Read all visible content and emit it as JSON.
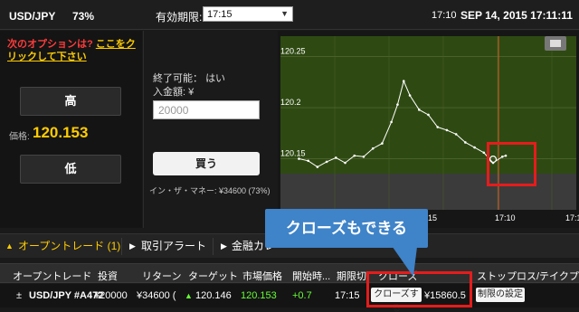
{
  "topbar": {
    "pair": "USD/JPY",
    "percent": "73%",
    "expiry_label": "有効期限:",
    "expiry_value": "17:15",
    "time_short": "17:10",
    "datetime": "SEP 14, 2015 17:11:11"
  },
  "left": {
    "promo_text": "次のオプションは?",
    "promo_link": "ここをクリックして下さい",
    "high_label": "高",
    "price_label": "価格:",
    "price_value": "120.153",
    "low_label": "低"
  },
  "mid": {
    "closable_label": "終了可能：",
    "closable_value": "はい",
    "amount_label": "入金額: ¥",
    "amount_placeholder": "20000",
    "buy_label": "買う",
    "in_the_money": "イン・ザ・マネー: ¥34600 (73%)"
  },
  "chart_data": {
    "type": "line",
    "series": [
      {
        "values": [
          {
            "x": "17:00",
            "y": 120.15
          },
          {
            "x": "17:00:30",
            "y": 120.148
          },
          {
            "x": "17:01",
            "y": 120.142
          },
          {
            "x": "17:01:30",
            "y": 120.147
          },
          {
            "x": "17:02",
            "y": 120.151
          },
          {
            "x": "17:02:30",
            "y": 120.146
          },
          {
            "x": "17:03",
            "y": 120.153
          },
          {
            "x": "17:03:30",
            "y": 120.152
          },
          {
            "x": "17:04",
            "y": 120.16
          },
          {
            "x": "17:04:30",
            "y": 120.165
          },
          {
            "x": "17:05",
            "y": 120.186
          },
          {
            "x": "17:05:20",
            "y": 120.203
          },
          {
            "x": "17:05:40",
            "y": 120.226
          },
          {
            "x": "17:06",
            "y": 120.212
          },
          {
            "x": "17:06:30",
            "y": 120.198
          },
          {
            "x": "17:07",
            "y": 120.193
          },
          {
            "x": "17:07:30",
            "y": 120.181
          },
          {
            "x": "17:08",
            "y": 120.178
          },
          {
            "x": "17:08:30",
            "y": 120.174
          },
          {
            "x": "17:09",
            "y": 120.166
          },
          {
            "x": "17:09:30",
            "y": 120.161
          },
          {
            "x": "17:10",
            "y": 120.156
          },
          {
            "x": "17:10:30",
            "y": 120.146
          },
          {
            "x": "17:11",
            "y": 120.152
          },
          {
            "x": "17:11:11",
            "y": 120.153
          }
        ]
      }
    ],
    "y_ticks": [
      "120.25",
      "120.2",
      "120.15"
    ],
    "x_ticks": [
      "15",
      "17:10",
      "17:15"
    ],
    "ylim": [
      120.1,
      120.27
    ],
    "strike": 120.15,
    "grid": true,
    "colors": {
      "background": "#2e4a12",
      "line": "#ffffff",
      "expiry_line": "#d4602a"
    }
  },
  "tabs": [
    {
      "label": "オープントレード (1)"
    },
    {
      "label": "取引アラート"
    },
    {
      "label": "金融カレ"
    }
  ],
  "table": {
    "headers": [
      "オープントレード",
      "投資",
      "リターン",
      "ターゲット",
      "市場価格",
      "開始時...",
      "期限切",
      "クローズ",
      "ストップロス/テイクプ..."
    ],
    "row": {
      "instrument": "USD/JPY #A472",
      "expand": "±",
      "investment": "¥20000",
      "return": "¥34600 (",
      "target": "120.146",
      "market": "120.153",
      "change": "+0.7",
      "expiry": "17:15",
      "close_btn": "クローズする",
      "close_value": "¥15860.5",
      "limit_btn": "制限の設定"
    }
  },
  "annotation": {
    "callout": "クローズもできる"
  }
}
